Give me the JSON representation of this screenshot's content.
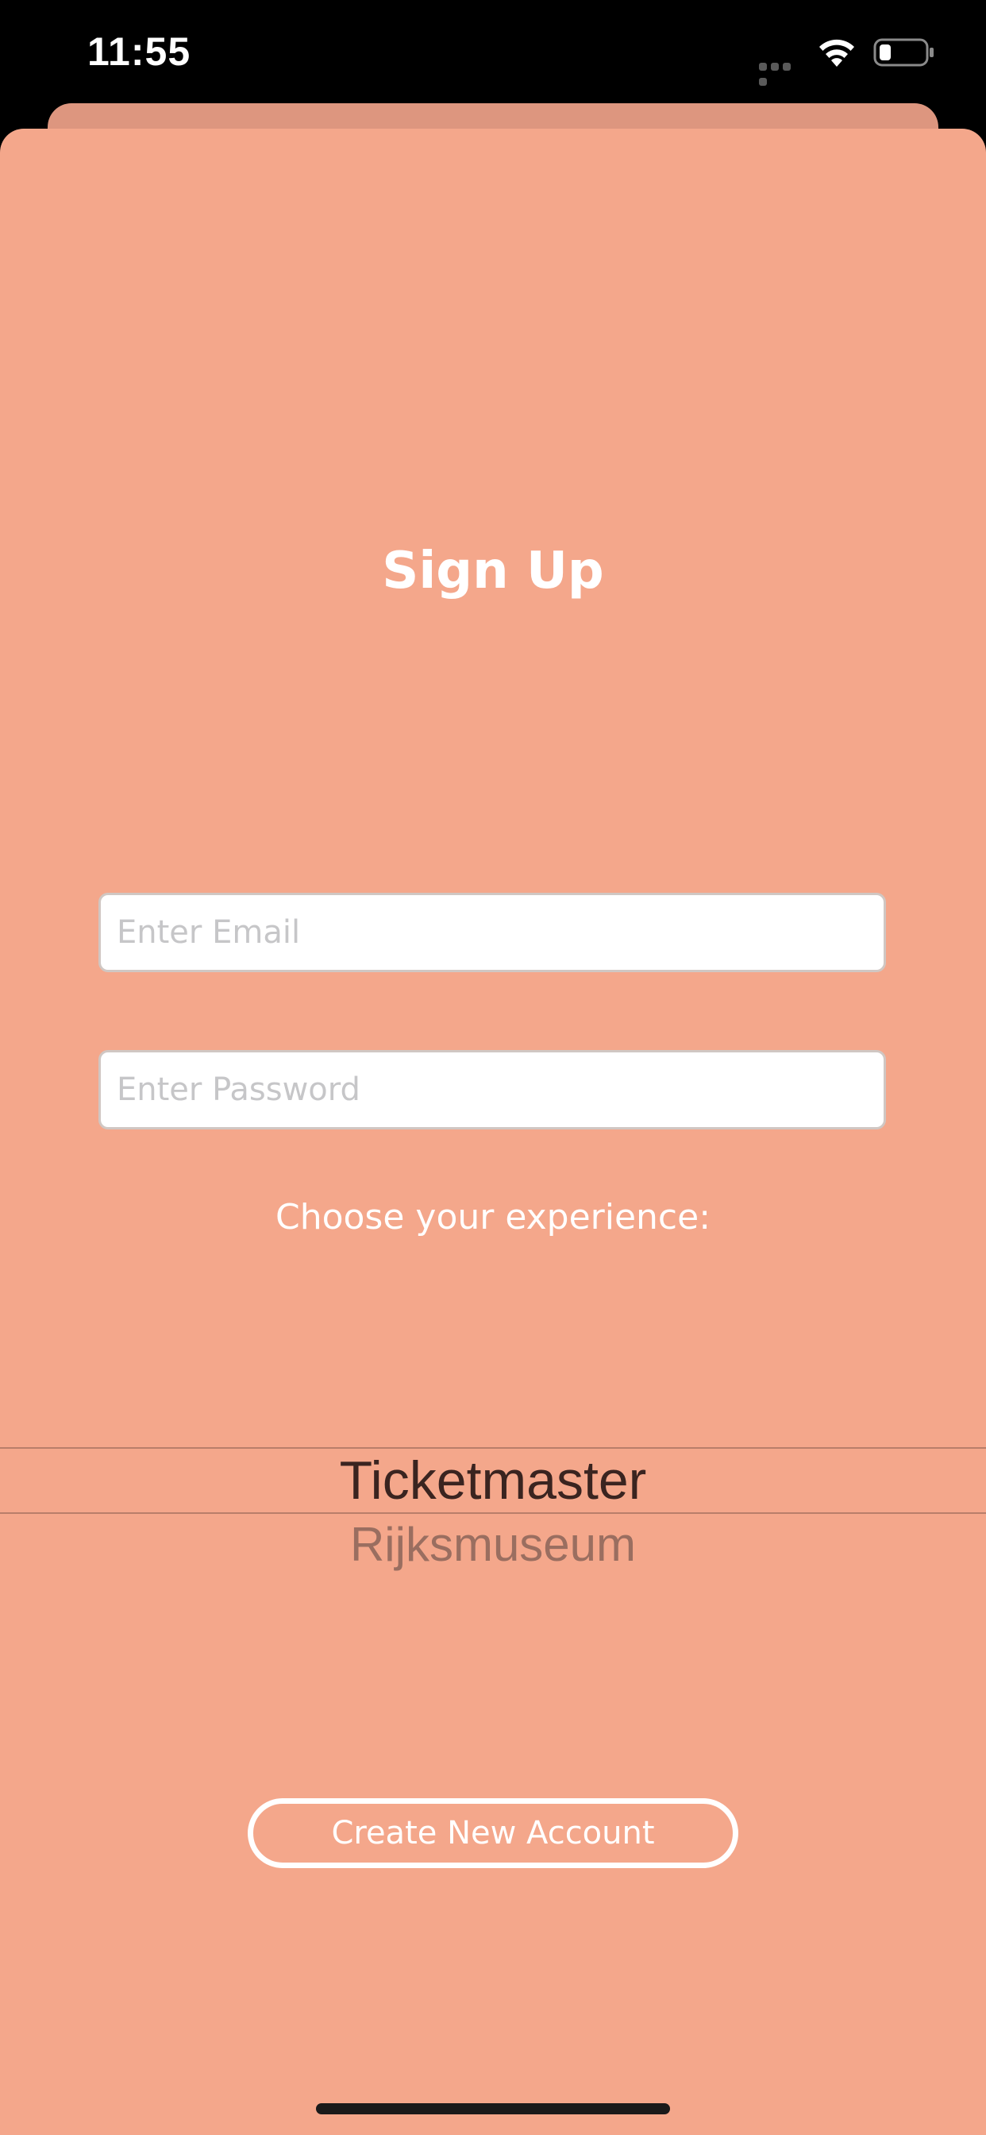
{
  "status_bar": {
    "time": "11:55",
    "icons": [
      "signal-dots-icon",
      "wifi-icon",
      "battery-icon"
    ]
  },
  "sign_up": {
    "title": "Sign Up",
    "email_placeholder": "Enter Email",
    "email_value": "",
    "password_placeholder": "Enter Password",
    "password_value": "",
    "choose_label": "Choose your experience:",
    "picker": {
      "selected": "Ticketmaster",
      "next": "Rijksmuseum"
    },
    "create_button_label": "Create New Account"
  },
  "colors": {
    "sheet_background": "#f4a78b",
    "back_card": "#dd967f",
    "status_bar_background": "#000000",
    "text_light": "#ffffff"
  }
}
